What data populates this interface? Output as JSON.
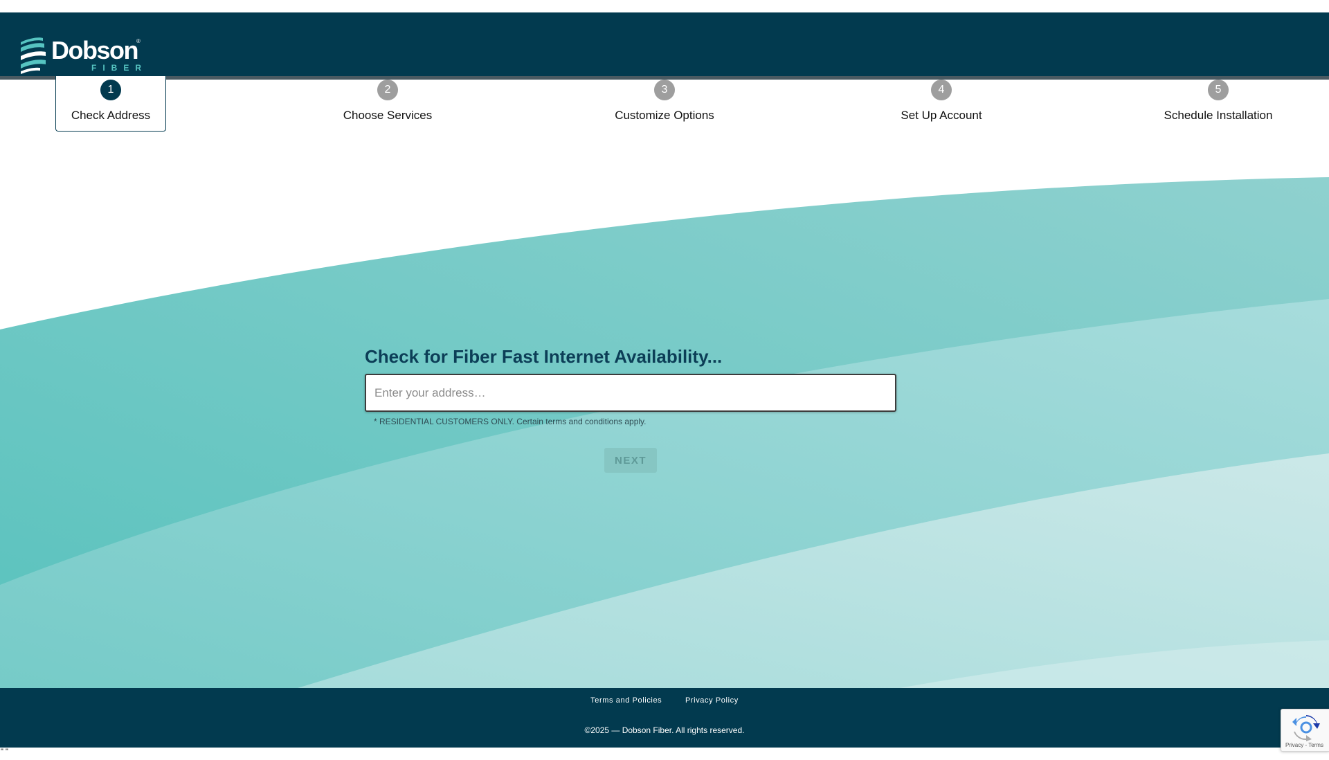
{
  "brand": {
    "name": "Dobson",
    "sub": "FIBER",
    "reg_mark": "®",
    "colors": {
      "navy": "#023a4f",
      "teal": "#56c4c1",
      "inactive_step": "#9e9e9e"
    }
  },
  "steps": [
    {
      "number": "1",
      "label": "Check Address",
      "active": true
    },
    {
      "number": "2",
      "label": "Choose Services",
      "active": false
    },
    {
      "number": "3",
      "label": "Customize Options",
      "active": false
    },
    {
      "number": "4",
      "label": "Set Up Account",
      "active": false
    },
    {
      "number": "5",
      "label": "Schedule Installation",
      "active": false
    }
  ],
  "form": {
    "title": "Check for Fiber Fast Internet Availability...",
    "address_placeholder": "Enter your address…",
    "address_value": "",
    "disclaimer": "* RESIDENTIAL CUSTOMERS ONLY. Certain terms and conditions apply.",
    "next_label": "NEXT",
    "next_enabled": false
  },
  "footer": {
    "links": [
      "Terms and Policies",
      "Privacy Policy"
    ],
    "copyright": "©2025 — Dobson Fiber. All rights reserved."
  },
  "recaptcha": {
    "text": "Privacy - Terms",
    "icon": "recaptcha-icon"
  },
  "stray_text": "\" \""
}
